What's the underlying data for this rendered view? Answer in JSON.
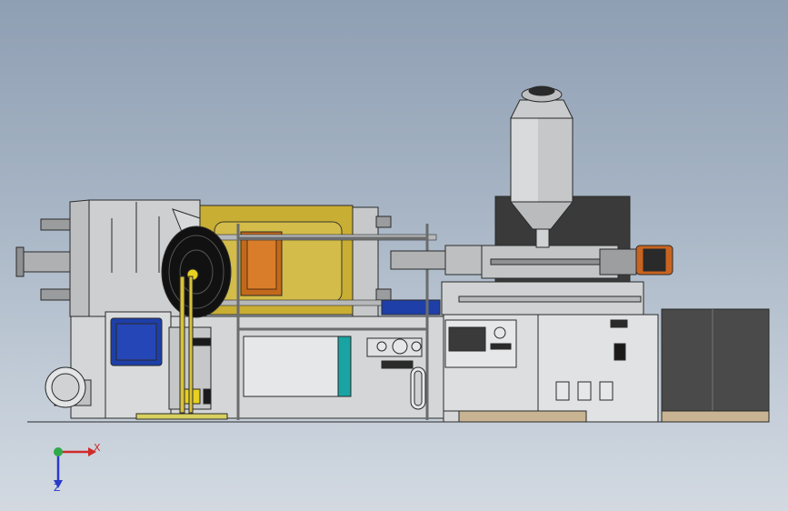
{
  "triad": {
    "x_label": "X",
    "z_label": "Z"
  },
  "colors": {
    "machine_gray": "#c9cbcc",
    "platen_yellow": "#c9ae34",
    "mold_orange": "#c2691b",
    "guard_blue": "#1e3fa8",
    "teal_accent": "#1aa3a3",
    "motor_orange": "#c8641f",
    "panel_dark": "#3a3a3a",
    "wood_pallet": "#c8b393"
  },
  "icons": [
    "axis-triad-icon",
    "globe-origin-icon"
  ]
}
